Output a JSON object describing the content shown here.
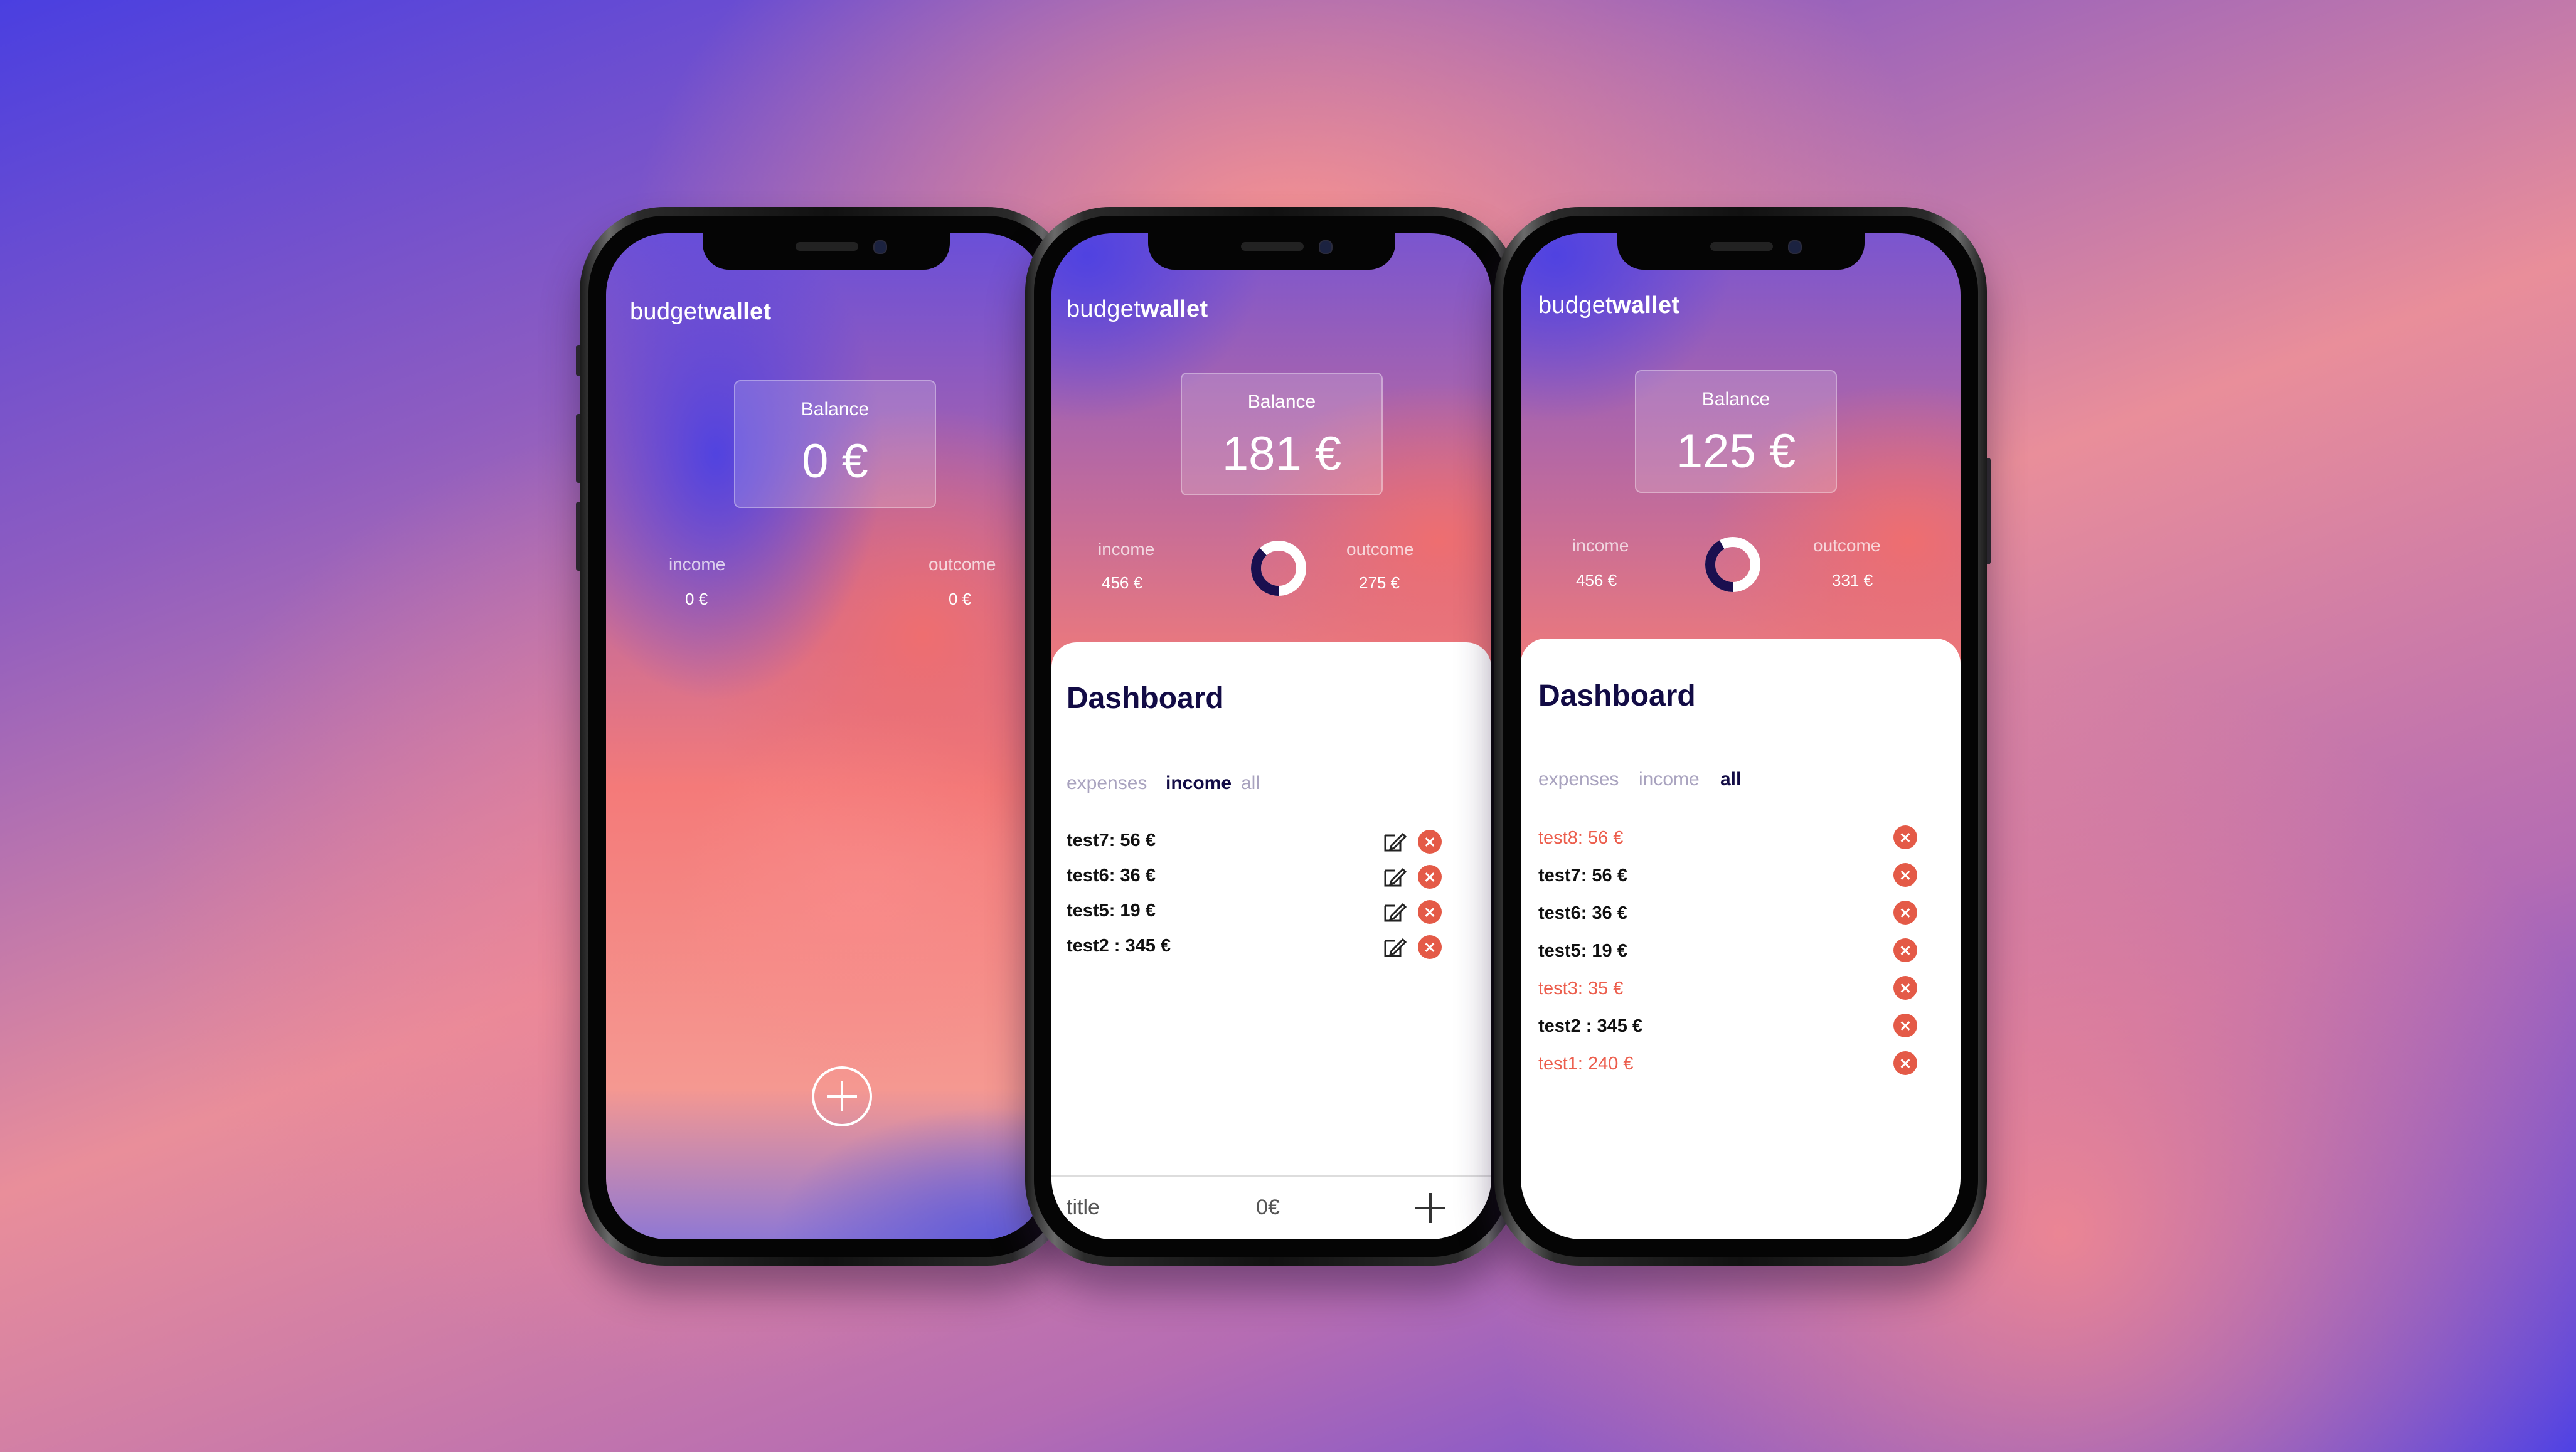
{
  "colors": {
    "accent_dark": "#120b45",
    "expense_red": "#ec5e4d",
    "delete_red": "#e45a47",
    "gradient_purple": "#4d41e2",
    "gradient_coral": "#f07070"
  },
  "phones": [
    {
      "logo_light": "budget",
      "logo_bold": "wallet",
      "balance_label": "Balance",
      "balance_value": "0 €",
      "income_label": "income",
      "income_value": "0 €",
      "outcome_label": "outcome",
      "outcome_value": "0 €",
      "add_button_icon": "plus-circle-icon"
    },
    {
      "logo_light": "budget",
      "logo_bold": "wallet",
      "balance_label": "Balance",
      "balance_value": "181 €",
      "income_label": "income",
      "income_value": "456 €",
      "outcome_label": "outcome",
      "outcome_value": "275 €",
      "donut_income_fraction": 0.62,
      "dashboard_title": "Dashboard",
      "tabs": [
        "expenses",
        "income",
        "all"
      ],
      "active_tab": "income",
      "items": [
        {
          "label": "test7: 56 €",
          "type": "income"
        },
        {
          "label": "test6: 36 €",
          "type": "income"
        },
        {
          "label": "test5: 19 €",
          "type": "income"
        },
        {
          "label": "test2 : 345 €",
          "type": "income"
        }
      ],
      "bottom_title_placeholder": "title",
      "bottom_amount_placeholder": "0€",
      "bottom_add_icon": "plus-icon"
    },
    {
      "logo_light": "budget",
      "logo_bold": "wallet",
      "balance_label": "Balance",
      "balance_value": "125 €",
      "income_label": "income",
      "income_value": "456 €",
      "outcome_label": "outcome",
      "outcome_value": "331 €",
      "donut_income_fraction": 0.58,
      "dashboard_title": "Dashboard",
      "tabs": [
        "expenses",
        "income",
        "all"
      ],
      "active_tab": "all",
      "items": [
        {
          "label": "test8: 56 €",
          "type": "expense"
        },
        {
          "label": "test7: 56 €",
          "type": "income"
        },
        {
          "label": "test6: 36 €",
          "type": "income"
        },
        {
          "label": "test5: 19 €",
          "type": "income"
        },
        {
          "label": "test3: 35 €",
          "type": "expense"
        },
        {
          "label": "test2 : 345 €",
          "type": "income"
        },
        {
          "label": "test1: 240 €",
          "type": "expense"
        }
      ]
    }
  ]
}
